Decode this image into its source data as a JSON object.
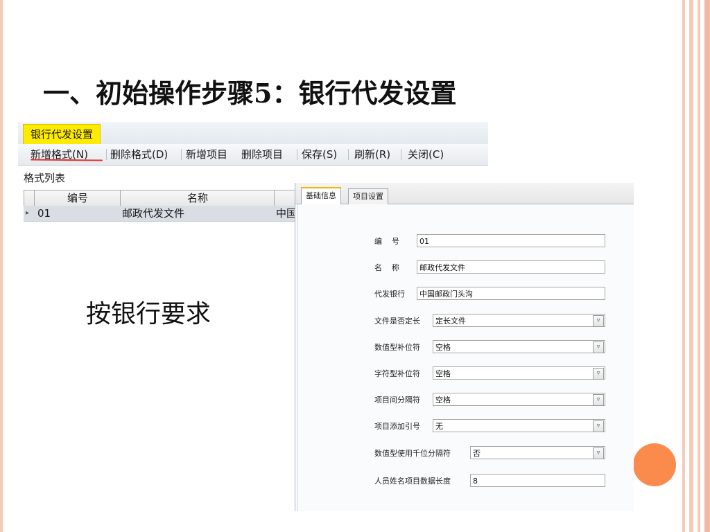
{
  "slide": {
    "title_main": "一、初始操作步骤",
    "title_num": "5",
    "title_sep": "：",
    "title_rest": "银行代发设置",
    "side_note": "按银行要求"
  },
  "window1": {
    "tab": "银行代发设置",
    "toolbar": [
      "新增格式(N)",
      "删除格式(D)",
      "新增项目",
      "删除项目",
      "保存(S)",
      "刷新(R)",
      "关闭(C)"
    ],
    "list_label": "格式列表",
    "columns": [
      "编号",
      "名称"
    ],
    "rows": [
      {
        "indicator": "▸",
        "code": "01",
        "name": "邮政代发文件",
        "bank": "中国"
      }
    ]
  },
  "window2": {
    "tabs": [
      "基础信息",
      "项目设置"
    ],
    "fields": [
      {
        "label": "编    号",
        "value": "01",
        "type": "input"
      },
      {
        "label": "名    称",
        "value": "邮政代发文件",
        "type": "input"
      },
      {
        "label": "代发银行",
        "value": "中国邮政门头沟",
        "type": "input"
      },
      {
        "label": "文件是否定长",
        "value": "定长文件",
        "type": "select"
      },
      {
        "label": "数值型补位符",
        "value": "空格",
        "type": "select"
      },
      {
        "label": "字符型补位符",
        "value": "空格",
        "type": "select"
      },
      {
        "label": "项目间分隔符",
        "value": "空格",
        "type": "select"
      },
      {
        "label": "项目添加引号",
        "value": "无",
        "type": "select"
      },
      {
        "label": "数值型使用千位分隔符",
        "value": "否",
        "type": "select"
      },
      {
        "label": "人员姓名项目数据长度",
        "value": "8",
        "type": "input"
      }
    ],
    "dropdown_arrow": "▿"
  },
  "colors": {
    "accent_tab": "#ffeb00",
    "underline": "#e0302c",
    "orange_dot": "#fb8b4d",
    "frame": "#f6c9b8"
  }
}
